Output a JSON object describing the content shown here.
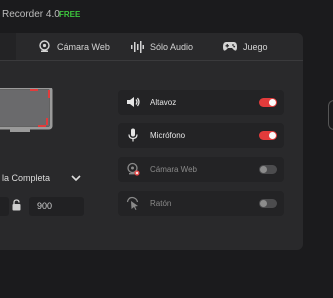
{
  "app": {
    "title": "Recorder 4.0",
    "badge": "FREE"
  },
  "tabs": [
    {
      "label": "Cámara Web",
      "icon": "webcam-icon"
    },
    {
      "label": "Sólo Audio",
      "icon": "waveform-icon"
    },
    {
      "label": "Juego",
      "icon": "gamepad-icon"
    }
  ],
  "screen": {
    "mode_label": "la Completa",
    "height_value": "900"
  },
  "devices": [
    {
      "label": "Altavoz",
      "icon": "speaker-icon",
      "on": true
    },
    {
      "label": "Micrófono",
      "icon": "microphone-icon",
      "on": true
    },
    {
      "label": "Cámara Web",
      "icon": "webcam-disabled-icon",
      "on": false
    },
    {
      "label": "Ratón",
      "icon": "mouse-click-icon",
      "on": false
    }
  ],
  "colors": {
    "accent": "#e23b3b",
    "badge": "#3cc53c",
    "panel": "#29292b"
  }
}
